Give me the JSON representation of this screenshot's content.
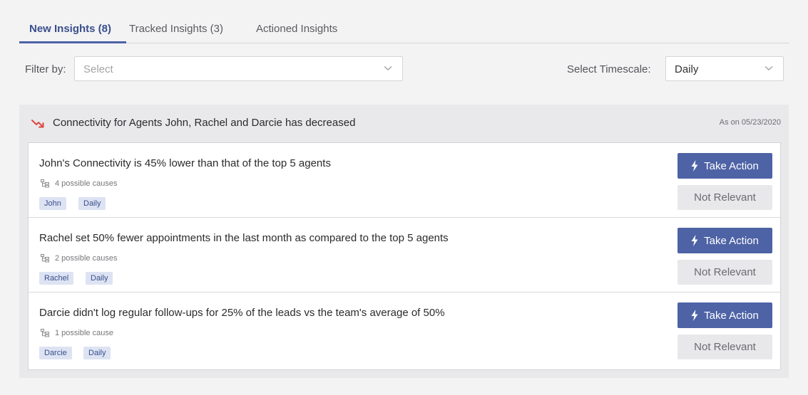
{
  "tabs": [
    {
      "label": "New Insights (8)"
    },
    {
      "label": "Tracked Insights (3)"
    },
    {
      "label": "Actioned Insights"
    }
  ],
  "filter": {
    "label": "Filter by:",
    "placeholder": "Select"
  },
  "timescale": {
    "label": "Select Timescale:",
    "value": "Daily"
  },
  "group": {
    "title": "Connectivity for Agents John, Rachel and Darcie has decreased",
    "as_of": "As on 05/23/2020",
    "trend_icon": "trend-down-icon",
    "trend_color": "#e0463f"
  },
  "insights": [
    {
      "text": "John's Connectivity is 45% lower than that of the top 5 agents",
      "causes": "4 possible causes",
      "tags": [
        "John",
        "Daily"
      ],
      "action_label": "Take Action",
      "dismiss_label": "Not Relevant"
    },
    {
      "text": "Rachel set 50% fewer appointments in the last month as compared to the top 5 agents",
      "causes": "2 possible causes",
      "tags": [
        "Rachel",
        "Daily"
      ],
      "action_label": "Take Action",
      "dismiss_label": "Not Relevant"
    },
    {
      "text": "Darcie didn't log regular follow-ups for 25% of the leads vs the team's average of 50%",
      "causes": "1 possible cause",
      "tags": [
        "Darcie",
        "Daily"
      ],
      "action_label": "Take Action",
      "dismiss_label": "Not Relevant"
    }
  ],
  "colors": {
    "accent": "#4e63a6",
    "chip_bg": "#dde3f3",
    "alert": "#e0463f"
  }
}
